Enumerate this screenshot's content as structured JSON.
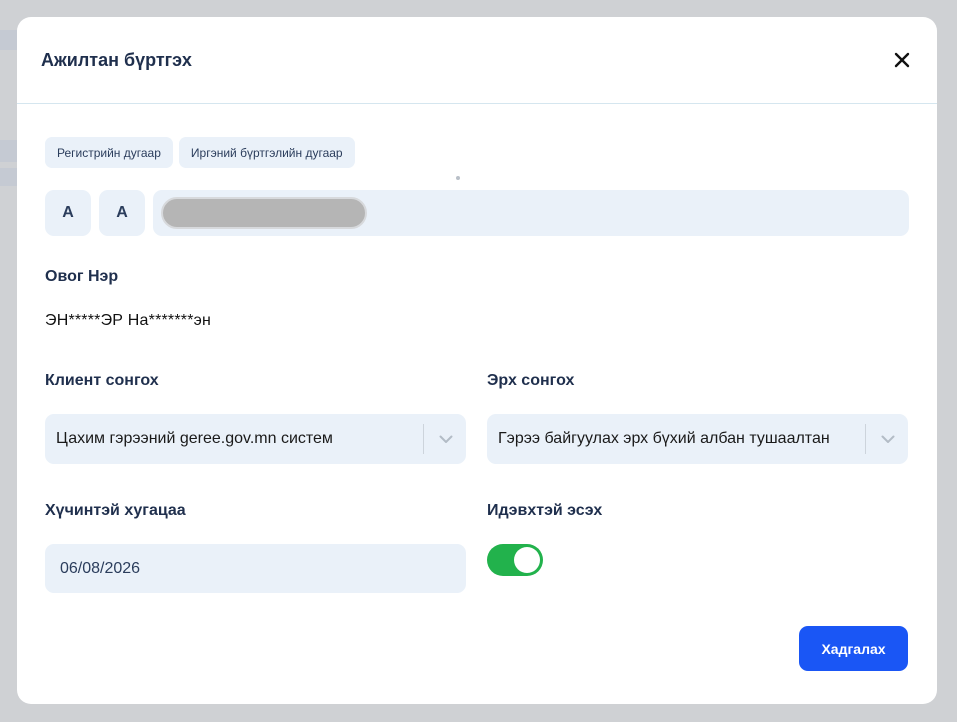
{
  "modal": {
    "title": "Ажилтан бүртгэх",
    "close_icon": "close-icon",
    "save_label": "Хадгалах"
  },
  "register": {
    "tabs": [
      "Регистрийн дугаар",
      "Иргэний бүртгэлийн дугаар"
    ],
    "letter1": "А",
    "letter2": "А"
  },
  "name": {
    "label": "Овог Нэр",
    "value": "ЭН*****ЭР На*******эн"
  },
  "client": {
    "label": "Клиент сонгох",
    "selected": "Цахим гэрээний geree.gov.mn систем"
  },
  "role": {
    "label": "Эрх сонгох",
    "selected": "Гэрээ байгуулах эрх бүхий албан тушаалтан"
  },
  "validity": {
    "label": "Хүчинтэй хугацаа",
    "value": "06/08/2026"
  },
  "active": {
    "label": "Идэвхтэй эсэх",
    "on": true
  },
  "colors": {
    "accent": "#1a56f5",
    "toggle_on": "#22b24c",
    "field_bg": "#eaf1f9",
    "title": "#1f2f4d"
  }
}
